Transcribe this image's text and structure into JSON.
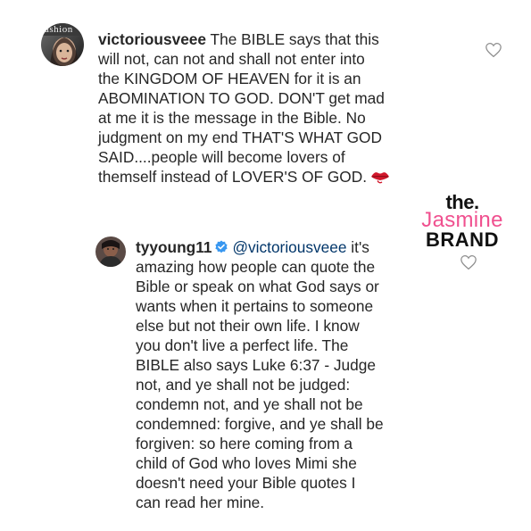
{
  "comment_main": {
    "username": "victoriousveee",
    "avatar_text": "ashion",
    "text_before_emoji": "The BIBLE says that this\nwill not, can not and shall not enter into\nthe KINGDOM OF HEAVEN for it is an\nABOMINATION TO GOD. DON'T get mad\nat me it is the message in the Bible.  No\njudgment on my end THAT'S WHAT GOD\nSAID....people will become lovers of\nthemself instead of LOVER'S OF GOD.",
    "emoji_icon": "kiss-mark-icon"
  },
  "reply": {
    "username": "tyyoung11",
    "verified_icon": "verified-badge-icon",
    "mention": "@victoriousveee",
    "text": " it's\namazing how people can quote the\nBible or speak on what God says or\nwants when it pertains to someone\nelse but not their own life. I know\nyou don't live a perfect life. The\nBIBLE also says Luke 6:37 - Judge\nnot, and ye shall not be judged:\ncondemn not, and ye shall not be\ncondemned: forgive, and ye shall be\nforgiven: so here coming from a\nchild of God who loves Mimi she\ndoesn't need your Bible quotes I\ncan read her mine."
  },
  "watermark": {
    "line1": "the.",
    "line2": "Jasmine",
    "line3": "BRAND"
  },
  "colors": {
    "text": "#262626",
    "mention": "#003569",
    "verified": "#3897f0",
    "watermark_pink": "#f0508f",
    "heart_outline": "#8e8e8e"
  }
}
